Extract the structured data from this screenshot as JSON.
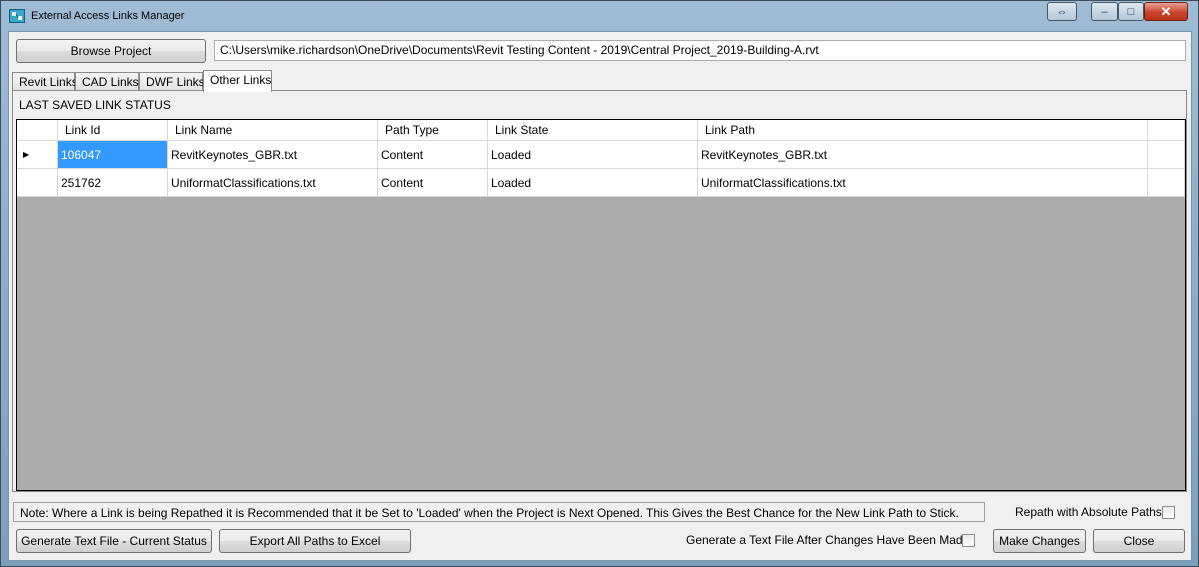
{
  "window": {
    "title": "External Access Links Manager",
    "controls": {
      "restore_glyph": "⇔",
      "minimize_glyph": "–",
      "maximize_glyph": "□",
      "close_glyph": "✕"
    }
  },
  "toolbar": {
    "browse_label": "Browse Project",
    "project_path": "C:\\Users\\mike.richardson\\OneDrive\\Documents\\Revit Testing Content - 2019\\Central Project_2019-Building-A.rvt"
  },
  "tabs": [
    {
      "label": "Revit Links"
    },
    {
      "label": "CAD Links"
    },
    {
      "label": "DWF Links"
    },
    {
      "label": "Other Links"
    }
  ],
  "panel": {
    "status_label": "LAST SAVED LINK STATUS"
  },
  "grid": {
    "columns": [
      "Link Id",
      "Link Name",
      "Path Type",
      "Link State",
      "Link Path"
    ],
    "rows": [
      [
        "106047",
        "RevitKeynotes_GBR.txt",
        "Content",
        "Loaded",
        "RevitKeynotes_GBR.txt"
      ],
      [
        "251762",
        "UniformatClassifications.txt",
        "Content",
        "Loaded",
        "UniformatClassifications.txt"
      ]
    ],
    "current_row_glyph": "▶"
  },
  "footer": {
    "note": "Note: Where a Link is being Repathed it is Recommended that it be Set to 'Loaded' when the Project is Next Opened. This Gives the Best Chance for the New Link Path to Stick.",
    "repath_label": "Repath with Absolute Paths",
    "generate_text_label": "Generate Text File - Current Status",
    "export_label": "Export All Paths to Excel",
    "generate_after_label": "Generate a Text File After Changes Have Been Made",
    "make_changes_label": "Make Changes",
    "close_label": "Close"
  },
  "colors": {
    "selection": "#3399ff",
    "grid_background": "#ababab",
    "frame": "#8fb0cb"
  },
  "icons": {
    "app": "app-window-icon"
  }
}
